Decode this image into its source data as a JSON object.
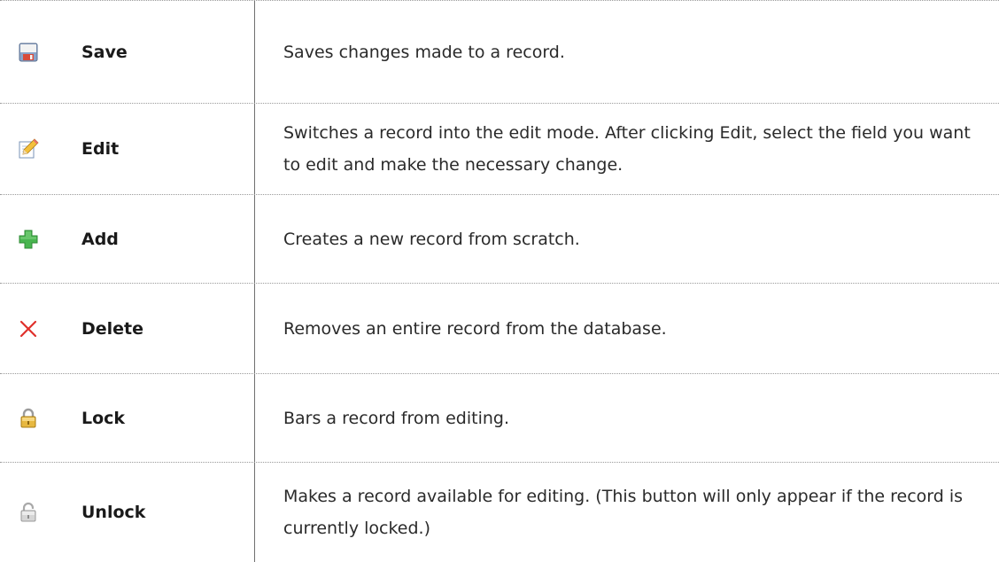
{
  "rows": [
    {
      "icon": "floppy-disk-icon",
      "name": "Save",
      "description": "Saves changes made to a record."
    },
    {
      "icon": "pencil-edit-icon",
      "name": "Edit",
      "description": "Switches a record into the edit mode. After clicking Edit, select the field you want to edit and make the necessary change."
    },
    {
      "icon": "plus-icon",
      "name": "Add",
      "description": "Creates a new record from scratch."
    },
    {
      "icon": "delete-x-icon",
      "name": "Delete",
      "description": "Removes an entire record from the database."
    },
    {
      "icon": "lock-closed-icon",
      "name": "Lock",
      "description": "Bars a record from editing."
    },
    {
      "icon": "lock-open-icon",
      "name": "Unlock",
      "description": "Makes a record available for editing. (This button will only appear if the record is currently locked.)"
    }
  ],
  "colors": {
    "divider": "#6f6f6f",
    "dotted_rule": "#9a9a9a",
    "add_green": "#3fb04a",
    "delete_red": "#e0302b",
    "lock_gold": "#e2b43c",
    "unlock_gray": "#b9b9b9"
  }
}
